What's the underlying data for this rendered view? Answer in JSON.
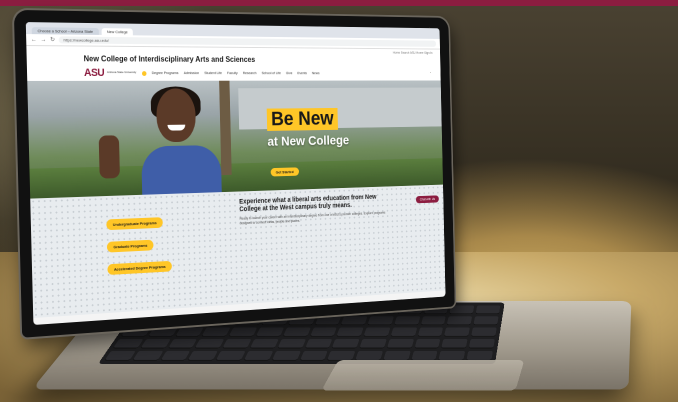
{
  "browser": {
    "tabs": [
      "Choose a School – Arizona State",
      "New College"
    ],
    "url": "https://newcollege.asu.edu/"
  },
  "site": {
    "utility_links": "Home   Search   ASU Home   Sign In",
    "college_title": "New College of Interdisciplinary Arts and Sciences",
    "logo_mark": "ASU",
    "logo_sub": "Arizona State University",
    "nav": [
      "Degree Programs",
      "Admission",
      "Student Life",
      "Faculty",
      "Research",
      "School of Life",
      "Give",
      "Events",
      "News"
    ]
  },
  "hero": {
    "headline_1": "Be New",
    "headline_2": "at New College",
    "cta": "Get Started"
  },
  "lower": {
    "buttons": [
      "Undergraduate Programs",
      "Graduate Programs",
      "Accelerated Degree Programs"
    ],
    "intro_heading": "Experience what a liberal arts education from New College at the West campus truly means.",
    "intro_text": "Ready to launch your career with an interdisciplinary degree from one of ASU's premier colleges. Explore programs designed to connect ideas, people and places.",
    "chat_label": "Chat with Us"
  },
  "colors": {
    "asu_maroon": "#8c1d40",
    "asu_gold": "#ffc627"
  }
}
